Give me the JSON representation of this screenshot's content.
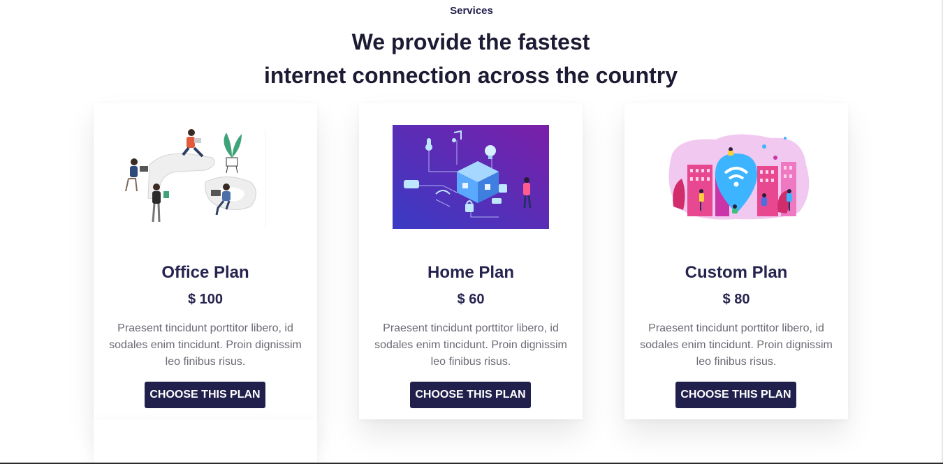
{
  "section": {
    "eyebrow": "Services",
    "headline_line1": "We provide the fastest",
    "headline_line2": "internet connection across the country"
  },
  "plans": [
    {
      "illustration": "office-coworking-illustration",
      "name": "Office Plan",
      "price": "$ 100",
      "description": "Praesent tincidunt porttitor libero, id sodales enim tincidunt. Proin dignissim leo finibus risus.",
      "button": "CHOOSE THIS PLAN"
    },
    {
      "illustration": "smart-home-network-illustration",
      "name": "Home Plan",
      "price": "$ 60",
      "description": "Praesent tincidunt porttitor libero, id sodales enim tincidunt. Proin dignissim leo finibus risus.",
      "button": "CHOOSE THIS PLAN"
    },
    {
      "illustration": "city-wifi-hotspot-illustration",
      "name": "Custom Plan",
      "price": "$ 80",
      "description": "Praesent tincidunt porttitor libero, id sodales enim tincidunt. Proin dignissim leo finibus risus.",
      "button": "CHOOSE THIS PLAN"
    }
  ],
  "colors": {
    "heading": "#1c1b33",
    "accent": "#21204d",
    "body_text": "#6b6b75",
    "card_bg": "#ffffff"
  }
}
